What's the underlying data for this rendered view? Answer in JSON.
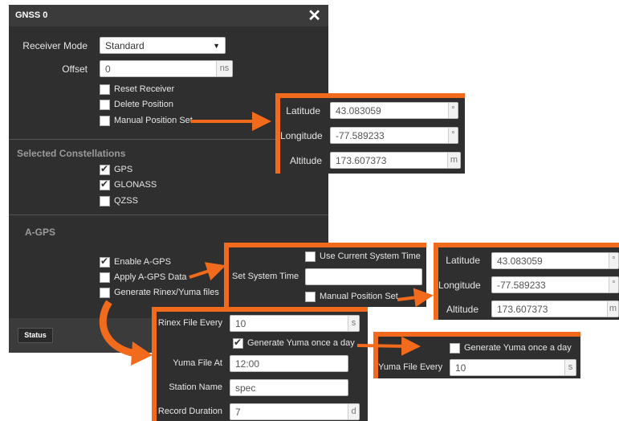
{
  "dialog": {
    "title": "GNSS 0",
    "close": "✕",
    "receiver_mode_label": "Receiver Mode",
    "receiver_mode_value": "Standard",
    "offset_label": "Offset",
    "offset_value": "0",
    "offset_unit": "ns",
    "reset_receiver": "Reset Receiver",
    "delete_position": "Delete Position",
    "manual_position_set": "Manual Position Set",
    "constellations_header": "Selected Constellations",
    "gps": "GPS",
    "glonass": "GLONASS",
    "qzss": "QZSS",
    "agps_header": "A-GPS",
    "enable_agps": "Enable A-GPS",
    "apply_agps": "Apply A-GPS Data",
    "generate_rinex": "Generate Rinex/Yuma files",
    "status_button": "Status"
  },
  "position_panel_1": {
    "latitude_label": "Latitude",
    "latitude_value": "43.083059",
    "latitude_unit": "°",
    "longitude_label": "Longitude",
    "longitude_value": "-77.589233",
    "longitude_unit": "°",
    "altitude_label": "Altitude",
    "altitude_value": "173.607373",
    "altitude_unit": "m"
  },
  "system_time_panel": {
    "label": "Set System Time",
    "use_current": "Use Current System Time",
    "input_value": "",
    "manual_position_set": "Manual Position Set"
  },
  "position_panel_2": {
    "latitude_label": "Latitude",
    "latitude_value": "43.083059",
    "latitude_unit": "°",
    "longitude_label": "Longitude",
    "longitude_value": "-77.589233",
    "longitude_unit": "°",
    "altitude_label": "Altitude",
    "altitude_value": "173.607373",
    "altitude_unit": "m"
  },
  "rinex_panel": {
    "rinex_every_label": "Rinex File Every",
    "rinex_every_value": "10",
    "rinex_every_unit": "s",
    "generate_yuma": "Generate Yuma once a day",
    "yuma_at_label": "Yuma File At",
    "yuma_at_value": "12:00",
    "station_label": "Station Name",
    "station_value": "spec",
    "duration_label": "Record Duration",
    "duration_value": "7",
    "duration_unit": "d"
  },
  "yuma_panel": {
    "generate_yuma": "Generate Yuma once a day",
    "yuma_every_label": "Yuma File Every",
    "yuma_every_value": "10",
    "yuma_every_unit": "s"
  },
  "colors": {
    "accent": "#f26a1b",
    "panel_bg": "#2f2f2f",
    "titlebar_bg": "#3b3b3b"
  }
}
